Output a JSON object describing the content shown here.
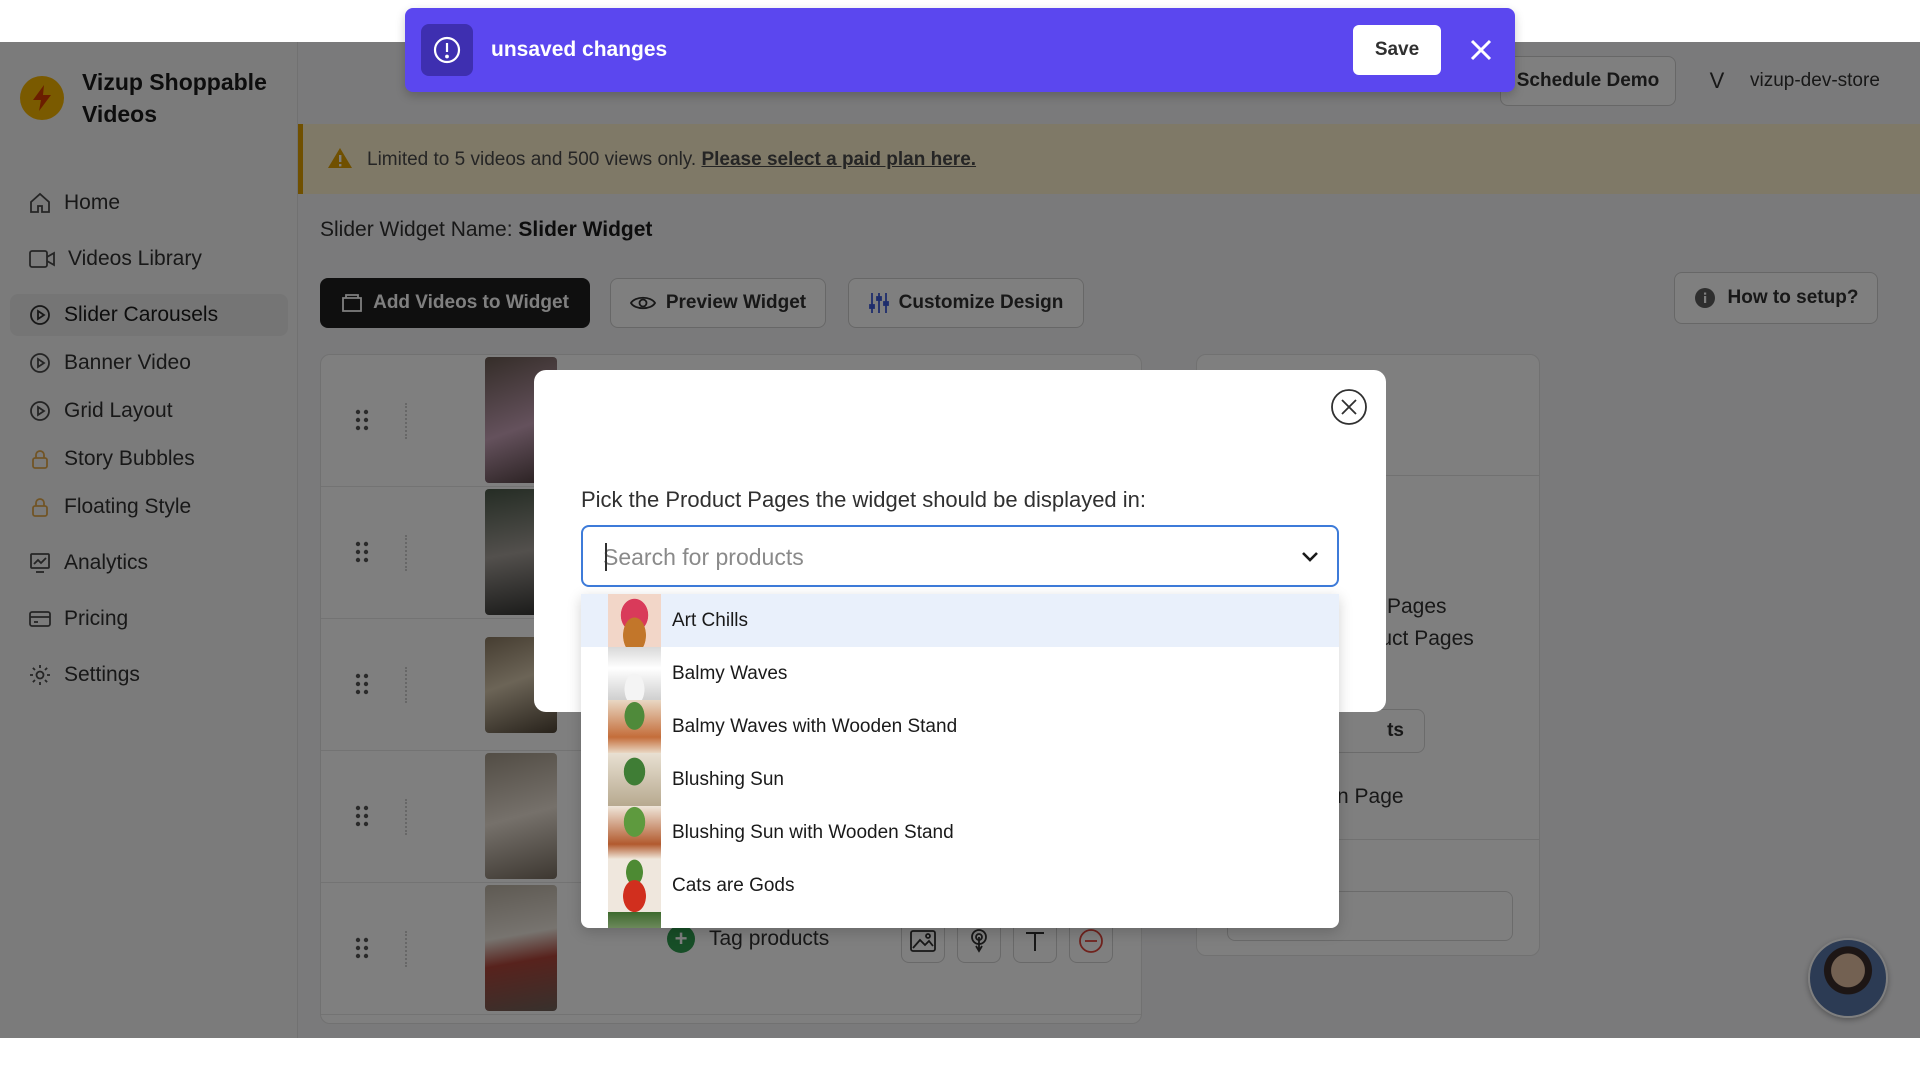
{
  "brand": {
    "title": "Vizup Shoppable Videos"
  },
  "sidebar": {
    "items": [
      {
        "label": "Home",
        "icon": "home-icon",
        "active": false
      },
      {
        "label": "Videos Library",
        "icon": "video-camera-icon",
        "active": false
      },
      {
        "label": "Slider Carousels",
        "icon": "play-circle-icon",
        "active": true
      },
      {
        "label": "Banner Video",
        "icon": "play-circle-icon",
        "active": false
      },
      {
        "label": "Grid Layout",
        "icon": "play-circle-icon",
        "active": false
      },
      {
        "label": "Story Bubbles",
        "icon": "lock-icon",
        "active": false
      },
      {
        "label": "Floating Style",
        "icon": "lock-icon",
        "active": false
      },
      {
        "label": "Analytics",
        "icon": "chart-icon",
        "active": false
      },
      {
        "label": "Pricing",
        "icon": "card-icon",
        "active": false
      },
      {
        "label": "Settings",
        "icon": "gear-icon",
        "active": false
      }
    ]
  },
  "header": {
    "schedule_label": "Schedule Demo",
    "store_initial": "V",
    "store_name": "vizup-dev-store"
  },
  "unsaved": {
    "message": "unsaved changes",
    "save_label": "Save"
  },
  "banner": {
    "text": "Limited to 5 videos and 500 views only.",
    "link_text": "Please select a paid plan here."
  },
  "main": {
    "widget_name_label": "Slider Widget Name:",
    "widget_name_value": "Slider Widget",
    "add_videos_label": "Add Videos to Widget",
    "preview_label": "Preview Widget",
    "customize_label": "Customize Design",
    "how_to_label": "How to setup?",
    "tag_products_label": "Tag products"
  },
  "side_panel": {
    "line1": "Pages",
    "line2": "oduct Pages",
    "button_partial": "ts",
    "line3": "n Page"
  },
  "modal": {
    "label": "Pick the Product Pages the widget should be displayed in:",
    "search_placeholder": "Search for products",
    "products": [
      "Art Chills",
      "Balmy Waves",
      "Balmy Waves with Wooden Stand",
      "Blushing Sun",
      "Blushing Sun with Wooden Stand",
      "Cats are Gods"
    ]
  },
  "colors": {
    "accent": "#5b47ef",
    "focus": "#3d7bd9",
    "warning_bg": "#fff2cf",
    "warning": "#e0a100"
  }
}
